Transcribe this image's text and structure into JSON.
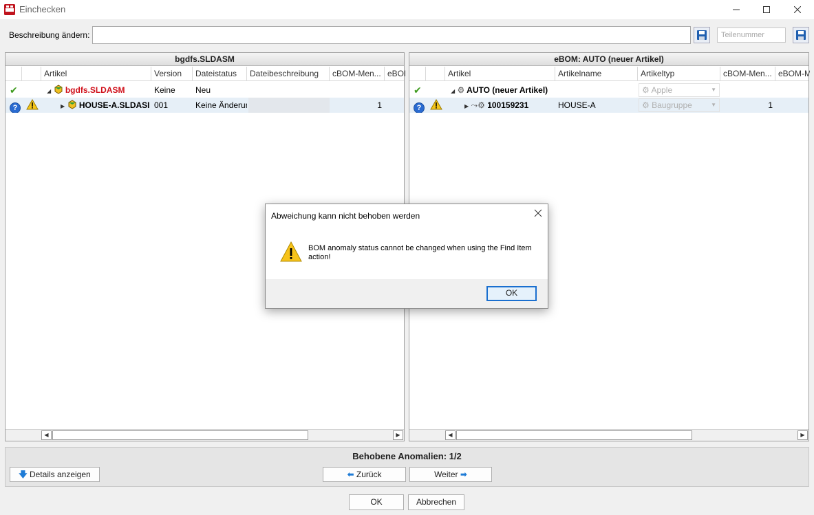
{
  "window": {
    "title": "Einchecken",
    "app_icon": "solidworks-2024-icon",
    "controls": [
      "minimize",
      "maximize",
      "close"
    ]
  },
  "description": {
    "label": "Beschreibung ändern:",
    "value": "",
    "part_number_placeholder": "Teilenummer"
  },
  "left_panel": {
    "title": "bgdfs.SLDASM",
    "columns": [
      "Artikel",
      "Version",
      "Dateistatus",
      "Dateibeschreibung",
      "cBOM-Men...",
      "eBOI"
    ],
    "rows": [
      {
        "status_icon": "check-icon",
        "name": "bgdfs.SLDASM",
        "version": "Keine",
        "file_status": "Neu",
        "file_desc": "",
        "cbom": "",
        "name_color": "#d0101a"
      },
      {
        "status_icon": "question-icon",
        "warn": true,
        "name": "HOUSE-A.SLDASI",
        "version": "001",
        "file_status": "Keine Änderur",
        "file_desc": "",
        "cbom": "1"
      }
    ]
  },
  "right_panel": {
    "title": "eBOM: AUTO (neuer Artikel)",
    "columns": [
      "Artikel",
      "Artikelname",
      "Artikeltyp",
      "cBOM-Men...",
      "eBOM-M"
    ],
    "rows": [
      {
        "status_icon": "check-icon",
        "item": "AUTO (neuer Artikel)",
        "item_name": "",
        "item_type": "Apple",
        "cbom": ""
      },
      {
        "status_icon": "question-icon",
        "warn": true,
        "item": "100159231",
        "item_name": "HOUSE-A",
        "item_type": "Baugruppe",
        "cbom": "1"
      }
    ]
  },
  "anomalies": {
    "text": "Behobene Anomalien: 1/2"
  },
  "buttons": {
    "details": "Details anzeigen",
    "back": "Zurück",
    "next": "Weiter",
    "ok": "OK",
    "cancel": "Abbrechen"
  },
  "dialog": {
    "title": "Abweichung kann nicht behoben werden",
    "message": "BOM anomaly status cannot be changed when using the Find Item action!",
    "ok": "OK"
  },
  "colors": {
    "accent": "#1e7bd6",
    "error_text": "#d0101a",
    "selection": "#e6eff7"
  }
}
